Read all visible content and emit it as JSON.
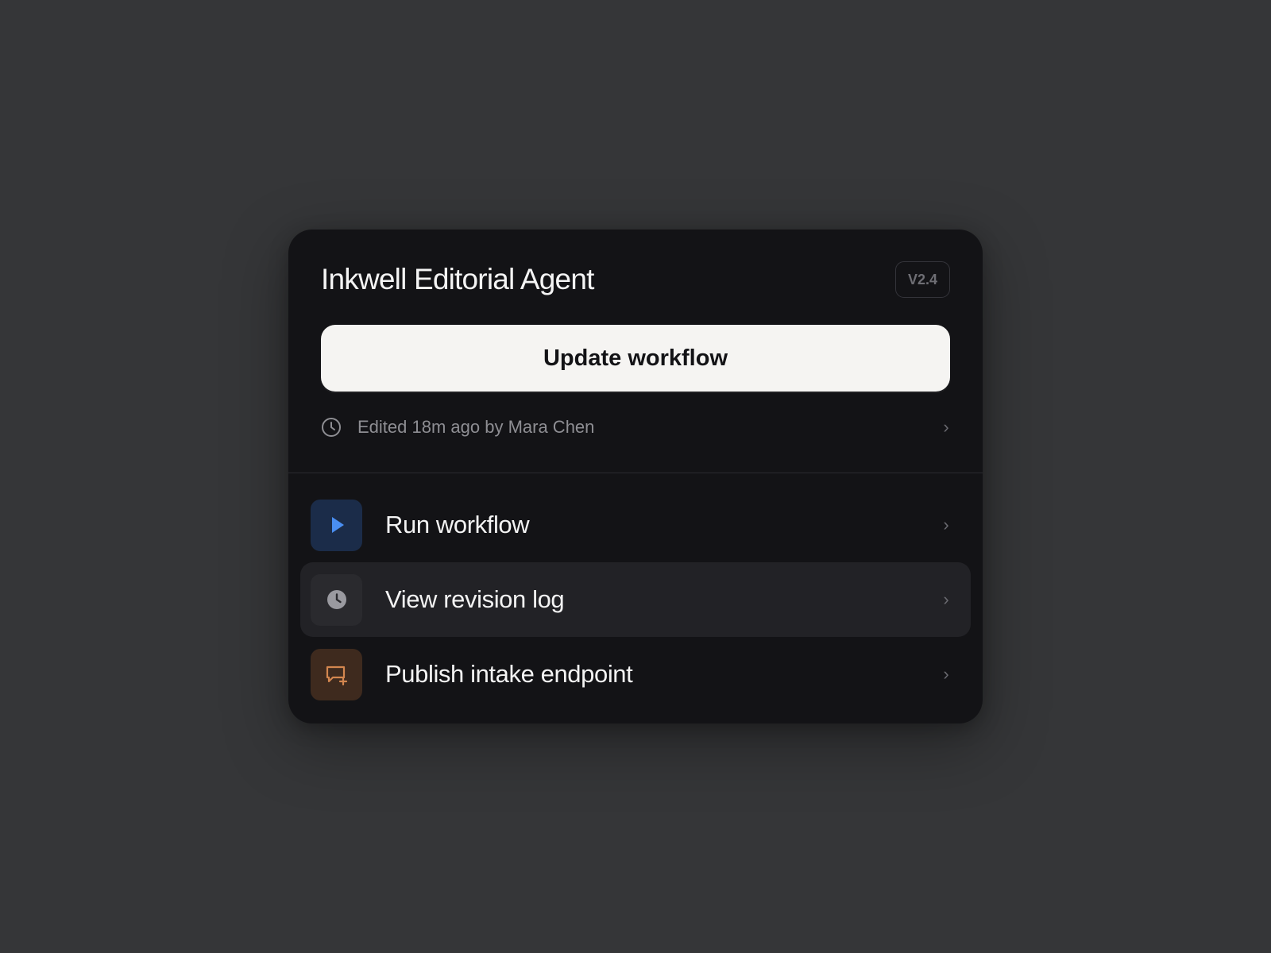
{
  "panel": {
    "title": "Inkwell Editorial Agent",
    "version_badge": "V2.4",
    "primary_action_label": "Update workflow",
    "edited_status": "Edited 18m ago by Mara Chen",
    "edited_icon": "clock-outline-icon",
    "chevron_glyph": "›"
  },
  "menu": {
    "items": [
      {
        "label": "Run workflow",
        "icon": "play-icon",
        "icon_bg": "#1b2c49",
        "icon_color": "#4a8ff2",
        "active": false
      },
      {
        "label": "View revision log",
        "icon": "clock-filled-icon",
        "icon_bg": "#2a2a2e",
        "icon_color": "#9a9aa0",
        "active": true
      },
      {
        "label": "Publish intake endpoint",
        "icon": "message-plus-icon",
        "icon_bg": "#3e2a1e",
        "icon_color": "#d3864f",
        "active": false
      }
    ]
  },
  "colors": {
    "page_bg": "#353638",
    "panel_bg": "#131316",
    "primary_button_bg": "#f5f4f2",
    "active_row_bg": "#222226"
  }
}
